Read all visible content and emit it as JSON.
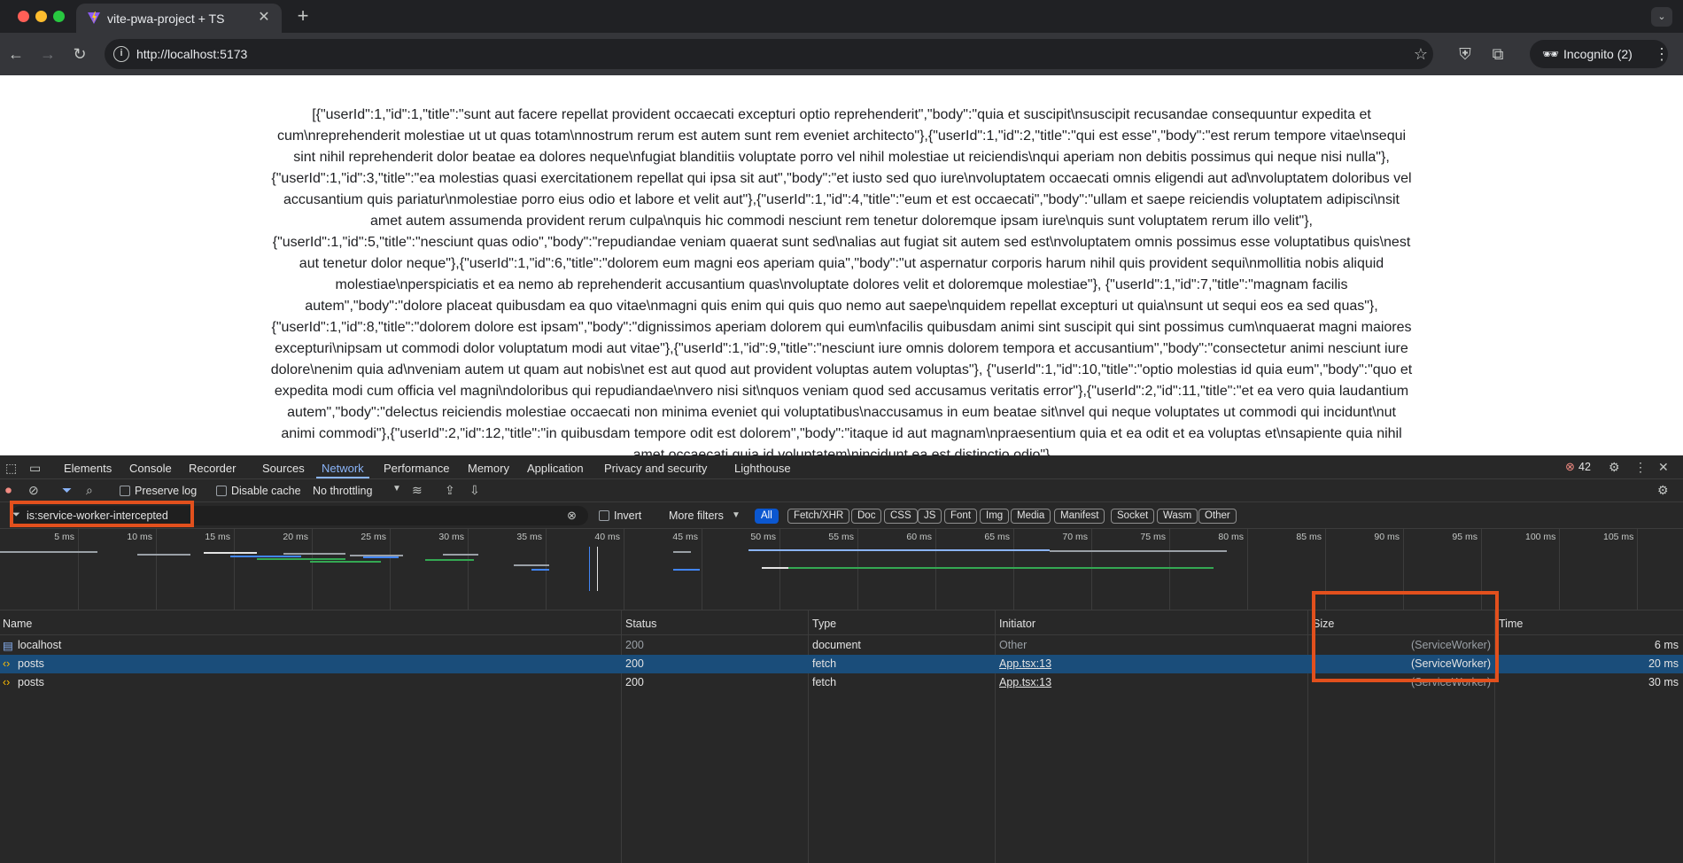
{
  "browser": {
    "tab_title": "vite-pwa-project + TS",
    "url": "http://localhost:5173",
    "incognito_label": "Incognito (2)"
  },
  "page": {
    "body_text": "[{\"userId\":1,\"id\":1,\"title\":\"sunt aut facere repellat provident occaecati excepturi optio reprehenderit\",\"body\":\"quia et suscipit\\nsuscipit recusandae consequuntur expedita et cum\\nreprehenderit molestiae ut ut quas totam\\nnostrum rerum est autem sunt rem eveniet architecto\"},{\"userId\":1,\"id\":2,\"title\":\"qui est esse\",\"body\":\"est rerum tempore vitae\\nsequi sint nihil reprehenderit dolor beatae ea dolores neque\\nfugiat blanditiis voluptate porro vel nihil molestiae ut reiciendis\\nqui aperiam non debitis possimus qui neque nisi nulla\"},{\"userId\":1,\"id\":3,\"title\":\"ea molestias quasi exercitationem repellat qui ipsa sit aut\",\"body\":\"et iusto sed quo iure\\nvoluptatem occaecati omnis eligendi aut ad\\nvoluptatem doloribus vel accusantium quis pariatur\\nmolestiae porro eius odio et labore et velit aut\"},{\"userId\":1,\"id\":4,\"title\":\"eum et est occaecati\",\"body\":\"ullam et saepe reiciendis voluptatem adipisci\\nsit amet autem assumenda provident rerum culpa\\nquis hic commodi nesciunt rem tenetur doloremque ipsam iure\\nquis sunt voluptatem rerum illo velit\"},{\"userId\":1,\"id\":5,\"title\":\"nesciunt quas odio\",\"body\":\"repudiandae veniam quaerat sunt sed\\nalias aut fugiat sit autem sed est\\nvoluptatem omnis possimus esse voluptatibus quis\\nest aut tenetur dolor neque\"},{\"userId\":1,\"id\":6,\"title\":\"dolorem eum magni eos aperiam quia\",\"body\":\"ut aspernatur corporis harum nihil quis provident sequi\\nmollitia nobis aliquid molestiae\\nperspiciatis et ea nemo ab reprehenderit accusantium quas\\nvoluptate dolores velit et doloremque molestiae\"}, {\"userId\":1,\"id\":7,\"title\":\"magnam facilis autem\",\"body\":\"dolore placeat quibusdam ea quo vitae\\nmagni quis enim qui quis quo nemo aut saepe\\nquidem repellat excepturi ut quia\\nsunt ut sequi eos ea sed quas\"},{\"userId\":1,\"id\":8,\"title\":\"dolorem dolore est ipsam\",\"body\":\"dignissimos aperiam dolorem qui eum\\nfacilis quibusdam animi sint suscipit qui sint possimus cum\\nquaerat magni maiores excepturi\\nipsam ut commodi dolor voluptatum modi aut vitae\"},{\"userId\":1,\"id\":9,\"title\":\"nesciunt iure omnis dolorem tempora et accusantium\",\"body\":\"consectetur animi nesciunt iure dolore\\nenim quia ad\\nveniam autem ut quam aut nobis\\net est aut quod aut provident voluptas autem voluptas\"}, {\"userId\":1,\"id\":10,\"title\":\"optio molestias id quia eum\",\"body\":\"quo et expedita modi cum officia vel magni\\ndoloribus qui repudiandae\\nvero nisi sit\\nquos veniam quod sed accusamus veritatis error\"},{\"userId\":2,\"id\":11,\"title\":\"et ea vero quia laudantium autem\",\"body\":\"delectus reiciendis molestiae occaecati non minima eveniet qui voluptatibus\\naccusamus in eum beatae sit\\nvel qui neque voluptates ut commodi qui incidunt\\nut animi commodi\"},{\"userId\":2,\"id\":12,\"title\":\"in quibusdam tempore odit est dolorem\",\"body\":\"itaque id aut magnam\\npraesentium quia et ea odit et ea voluptas et\\nsapiente quia nihil amet occaecati quia id voluptatem\\nincidunt ea est distinctio odio\"}"
  },
  "devtools": {
    "tabs": [
      "Elements",
      "Console",
      "Recorder",
      "Sources",
      "Network",
      "Performance",
      "Memory",
      "Application",
      "Privacy and security",
      "Lighthouse"
    ],
    "error_count": "42",
    "preserve_log": "Preserve log",
    "disable_cache": "Disable cache",
    "throttling": "No throttling",
    "filter_value": "is:service-worker-intercepted",
    "invert": "Invert",
    "more_filters": "More filters",
    "chips": [
      "All",
      "Fetch/XHR",
      "Doc",
      "CSS",
      "JS",
      "Font",
      "Img",
      "Media",
      "Manifest",
      "Socket",
      "Wasm",
      "Other"
    ],
    "timeline_ticks": [
      "5 ms",
      "10 ms",
      "15 ms",
      "20 ms",
      "25 ms",
      "30 ms",
      "35 ms",
      "40 ms",
      "45 ms",
      "50 ms",
      "55 ms",
      "60 ms",
      "65 ms",
      "70 ms",
      "75 ms",
      "80 ms",
      "85 ms",
      "90 ms",
      "95 ms",
      "100 ms",
      "105 ms"
    ],
    "columns": [
      "Name",
      "Status",
      "Type",
      "Initiator",
      "Size",
      "Time"
    ],
    "rows": [
      {
        "name": "localhost",
        "status": "200",
        "type": "document",
        "initiator": "Other",
        "size": "(ServiceWorker)",
        "time": "6 ms"
      },
      {
        "name": "posts",
        "status": "200",
        "type": "fetch",
        "initiator": "App.tsx:13",
        "size": "(ServiceWorker)",
        "time": "20 ms"
      },
      {
        "name": "posts",
        "status": "200",
        "type": "fetch",
        "initiator": "App.tsx:13",
        "size": "(ServiceWorker)",
        "time": "30 ms"
      }
    ]
  },
  "colors": {
    "accent": "#8ab4f8",
    "highlight_box": "#e2501d",
    "selected_row": "#1a4d7a"
  }
}
